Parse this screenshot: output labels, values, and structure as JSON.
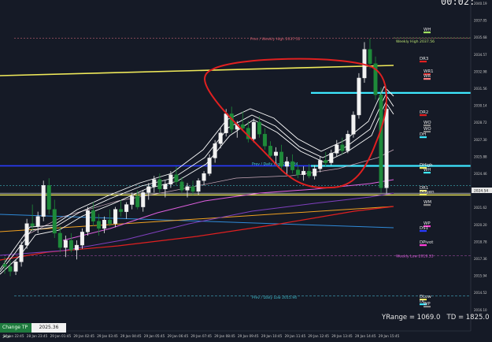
{
  "timer": "00:02:",
  "panel": {
    "change_tp_label": "Change TP >>",
    "tp_value": "2025.36"
  },
  "stats": {
    "yrange_label": "YRange = 1069.0",
    "td_label": "TD = 1825.0"
  },
  "colors": {
    "background": "#151a26",
    "bull": "#f2f2f2",
    "bear": "#1e8a3a",
    "cyan": "#3ee8ff",
    "yellow": "#f0ea5a",
    "red": "#e02020",
    "magenta": "#ff3fd8"
  },
  "axis": {
    "price_labels": [
      "2040.19",
      "2037.05",
      "2035.68",
      "2034.57",
      "2032.98",
      "2031.56",
      "2030.14",
      "2028.72",
      "2027.30",
      "2025.88",
      "2024.46",
      "2023.04",
      "2021.62",
      "2020.20",
      "2018.78",
      "2017.36",
      "2015.94",
      "2014.52",
      "2016.10"
    ],
    "current_price": "2024.54",
    "time_labels": [
      "26 Jan 22:45",
      "28 Jan 23:45",
      "29 Jan 01:45",
      "29 Jan 02:45",
      "29 Jan 03:45",
      "29 Jan 04:45",
      "29 Jan 05:45",
      "29 Jan 06:45",
      "29 Jan 07:45",
      "29 Jan 08:45",
      "29 Jan 09:45",
      "29 Jan 10:45",
      "29 Jan 11:45",
      "29 Jan 12:45",
      "29 Jan 13:45",
      "29 Jan 14:45",
      "29 Jan 15:45"
    ]
  },
  "levels": [
    {
      "label": "Prev / Weekly High 2037.52",
      "color": "#d86070"
    },
    {
      "label": "Weekly High 2037.56",
      "color": "#b8e070"
    },
    {
      "label": "Prev / Daily High 2026.84",
      "color": "#4ad8e0"
    },
    {
      "label": "Weekly Low 2019.33",
      "color": "#e060e0"
    },
    {
      "label": "Prev / Daily Low 2015.94",
      "color": "#40c0d0"
    }
  ],
  "right_labels": [
    {
      "text": "WH",
      "color": "#e0e0e0"
    },
    {
      "text": "DR3",
      "color": "#e8e8e8"
    },
    {
      "text": "WR1",
      "color": "#e8e8e8"
    },
    {
      "text": "WR",
      "color": "#e8e8e8"
    },
    {
      "text": "DR2",
      "color": "#e8e8e8"
    },
    {
      "text": "WO",
      "color": "#e8e8e8"
    },
    {
      "text": "WO",
      "color": "#e8e8e8"
    },
    {
      "text": "DH",
      "color": "#e8e8e8"
    },
    {
      "text": "DHigh",
      "color": "#e8e8e8"
    },
    {
      "text": "WH",
      "color": "#e8e8e8"
    },
    {
      "text": "DR1",
      "color": "#e8e8e8"
    },
    {
      "text": "DOpen",
      "color": "#e8e8e8"
    },
    {
      "text": "WM",
      "color": "#e8e8e8"
    },
    {
      "text": "WP",
      "color": "#e8e8e8"
    },
    {
      "text": "DS1",
      "color": "#e8e8e8"
    },
    {
      "text": "DPivot",
      "color": "#e8e8e8"
    },
    {
      "text": "DLow",
      "color": "#e8e8e8"
    },
    {
      "text": "DL",
      "color": "#e8e8e8"
    },
    {
      "text": "WP",
      "color": "#e8e8e8"
    }
  ],
  "candles": [
    [
      2018.6,
      2019.2,
      2017.8,
      2018.4
    ],
    [
      2018.4,
      2018.9,
      2017.6,
      2018.0
    ],
    [
      2018.0,
      2019.0,
      2017.7,
      2018.8
    ],
    [
      2018.8,
      2020.5,
      2018.4,
      2020.2
    ],
    [
      2020.2,
      2022.4,
      2019.9,
      2022.0
    ],
    [
      2022.0,
      2023.6,
      2021.4,
      2021.8
    ],
    [
      2021.8,
      2023.0,
      2021.2,
      2022.6
    ],
    [
      2022.6,
      2025.6,
      2022.2,
      2025.2
    ],
    [
      2025.2,
      2025.8,
      2022.8,
      2023.2
    ],
    [
      2023.2,
      2024.0,
      2020.8,
      2021.2
    ],
    [
      2021.2,
      2021.8,
      2019.6,
      2020.0
    ],
    [
      2020.0,
      2021.0,
      2019.2,
      2020.6
    ],
    [
      2020.6,
      2021.2,
      2019.6,
      2019.8
    ],
    [
      2019.8,
      2020.6,
      2019.0,
      2020.2
    ],
    [
      2020.2,
      2021.6,
      2019.9,
      2021.3
    ],
    [
      2021.3,
      2023.4,
      2021.0,
      2023.1
    ],
    [
      2023.1,
      2023.8,
      2021.8,
      2022.2
    ],
    [
      2022.2,
      2022.8,
      2021.0,
      2021.6
    ],
    [
      2021.6,
      2022.6,
      2021.2,
      2022.3
    ],
    [
      2022.3,
      2023.2,
      2021.8,
      2022.0
    ],
    [
      2022.0,
      2023.4,
      2021.7,
      2023.2
    ],
    [
      2023.2,
      2024.0,
      2022.6,
      2023.0
    ],
    [
      2023.0,
      2023.8,
      2022.4,
      2023.6
    ],
    [
      2023.6,
      2024.6,
      2023.2,
      2024.3
    ],
    [
      2024.3,
      2024.8,
      2023.2,
      2023.4
    ],
    [
      2023.4,
      2024.8,
      2023.0,
      2024.6
    ],
    [
      2024.6,
      2025.4,
      2024.0,
      2025.1
    ],
    [
      2025.1,
      2026.0,
      2024.6,
      2025.7
    ],
    [
      2025.7,
      2026.2,
      2024.6,
      2024.9
    ],
    [
      2024.9,
      2025.6,
      2024.2,
      2025.3
    ],
    [
      2025.3,
      2026.4,
      2025.0,
      2026.1
    ],
    [
      2026.1,
      2026.8,
      2025.2,
      2025.5
    ],
    [
      2025.5,
      2025.9,
      2024.6,
      2024.8
    ],
    [
      2024.8,
      2025.4,
      2024.2,
      2025.1
    ],
    [
      2025.1,
      2025.6,
      2024.4,
      2024.7
    ],
    [
      2024.7,
      2025.8,
      2024.4,
      2025.6
    ],
    [
      2025.6,
      2026.4,
      2025.2,
      2026.2
    ],
    [
      2026.2,
      2027.8,
      2026.0,
      2027.5
    ],
    [
      2027.5,
      2029.0,
      2027.1,
      2028.7
    ],
    [
      2028.7,
      2030.0,
      2028.3,
      2029.6
    ],
    [
      2029.6,
      2031.6,
      2029.3,
      2031.2
    ],
    [
      2031.2,
      2031.8,
      2029.6,
      2029.9
    ],
    [
      2029.9,
      2030.6,
      2029.2,
      2030.3
    ],
    [
      2030.3,
      2031.4,
      2029.8,
      2030.0
    ],
    [
      2030.0,
      2030.6,
      2028.8,
      2029.1
    ],
    [
      2029.1,
      2030.8,
      2028.8,
      2030.5
    ],
    [
      2030.5,
      2031.0,
      2029.2,
      2029.5
    ],
    [
      2029.5,
      2030.0,
      2028.2,
      2028.5
    ],
    [
      2028.5,
      2028.9,
      2027.4,
      2027.7
    ],
    [
      2027.7,
      2028.4,
      2026.9,
      2028.0
    ],
    [
      2028.0,
      2028.6,
      2026.4,
      2026.8
    ],
    [
      2026.8,
      2027.6,
      2026.1,
      2027.2
    ],
    [
      2027.2,
      2027.8,
      2026.2,
      2026.5
    ],
    [
      2026.5,
      2026.9,
      2025.8,
      2026.1
    ],
    [
      2026.1,
      2026.8,
      2025.6,
      2026.4
    ],
    [
      2026.4,
      2027.0,
      2025.8,
      2026.0
    ],
    [
      2026.0,
      2026.9,
      2025.7,
      2026.6
    ],
    [
      2026.6,
      2027.6,
      2026.3,
      2027.3
    ],
    [
      2027.3,
      2028.0,
      2026.8,
      2027.1
    ],
    [
      2027.1,
      2028.2,
      2026.9,
      2027.9
    ],
    [
      2027.9,
      2029.0,
      2027.6,
      2028.6
    ],
    [
      2028.6,
      2029.2,
      2027.8,
      2028.1
    ],
    [
      2028.1,
      2029.8,
      2027.9,
      2029.5
    ],
    [
      2029.5,
      2031.4,
      2029.2,
      2031.1
    ],
    [
      2031.1,
      2034.6,
      2030.8,
      2034.2
    ],
    [
      2034.2,
      2037.2,
      2033.8,
      2036.6
    ],
    [
      2036.6,
      2037.5,
      2035.0,
      2035.4
    ],
    [
      2035.4,
      2036.0,
      2032.4,
      2032.8
    ],
    [
      2032.8,
      2033.4,
      2024.6,
      2025.0
    ],
    [
      2025.0,
      2031.9,
      2024.5,
      2031.6
    ]
  ]
}
